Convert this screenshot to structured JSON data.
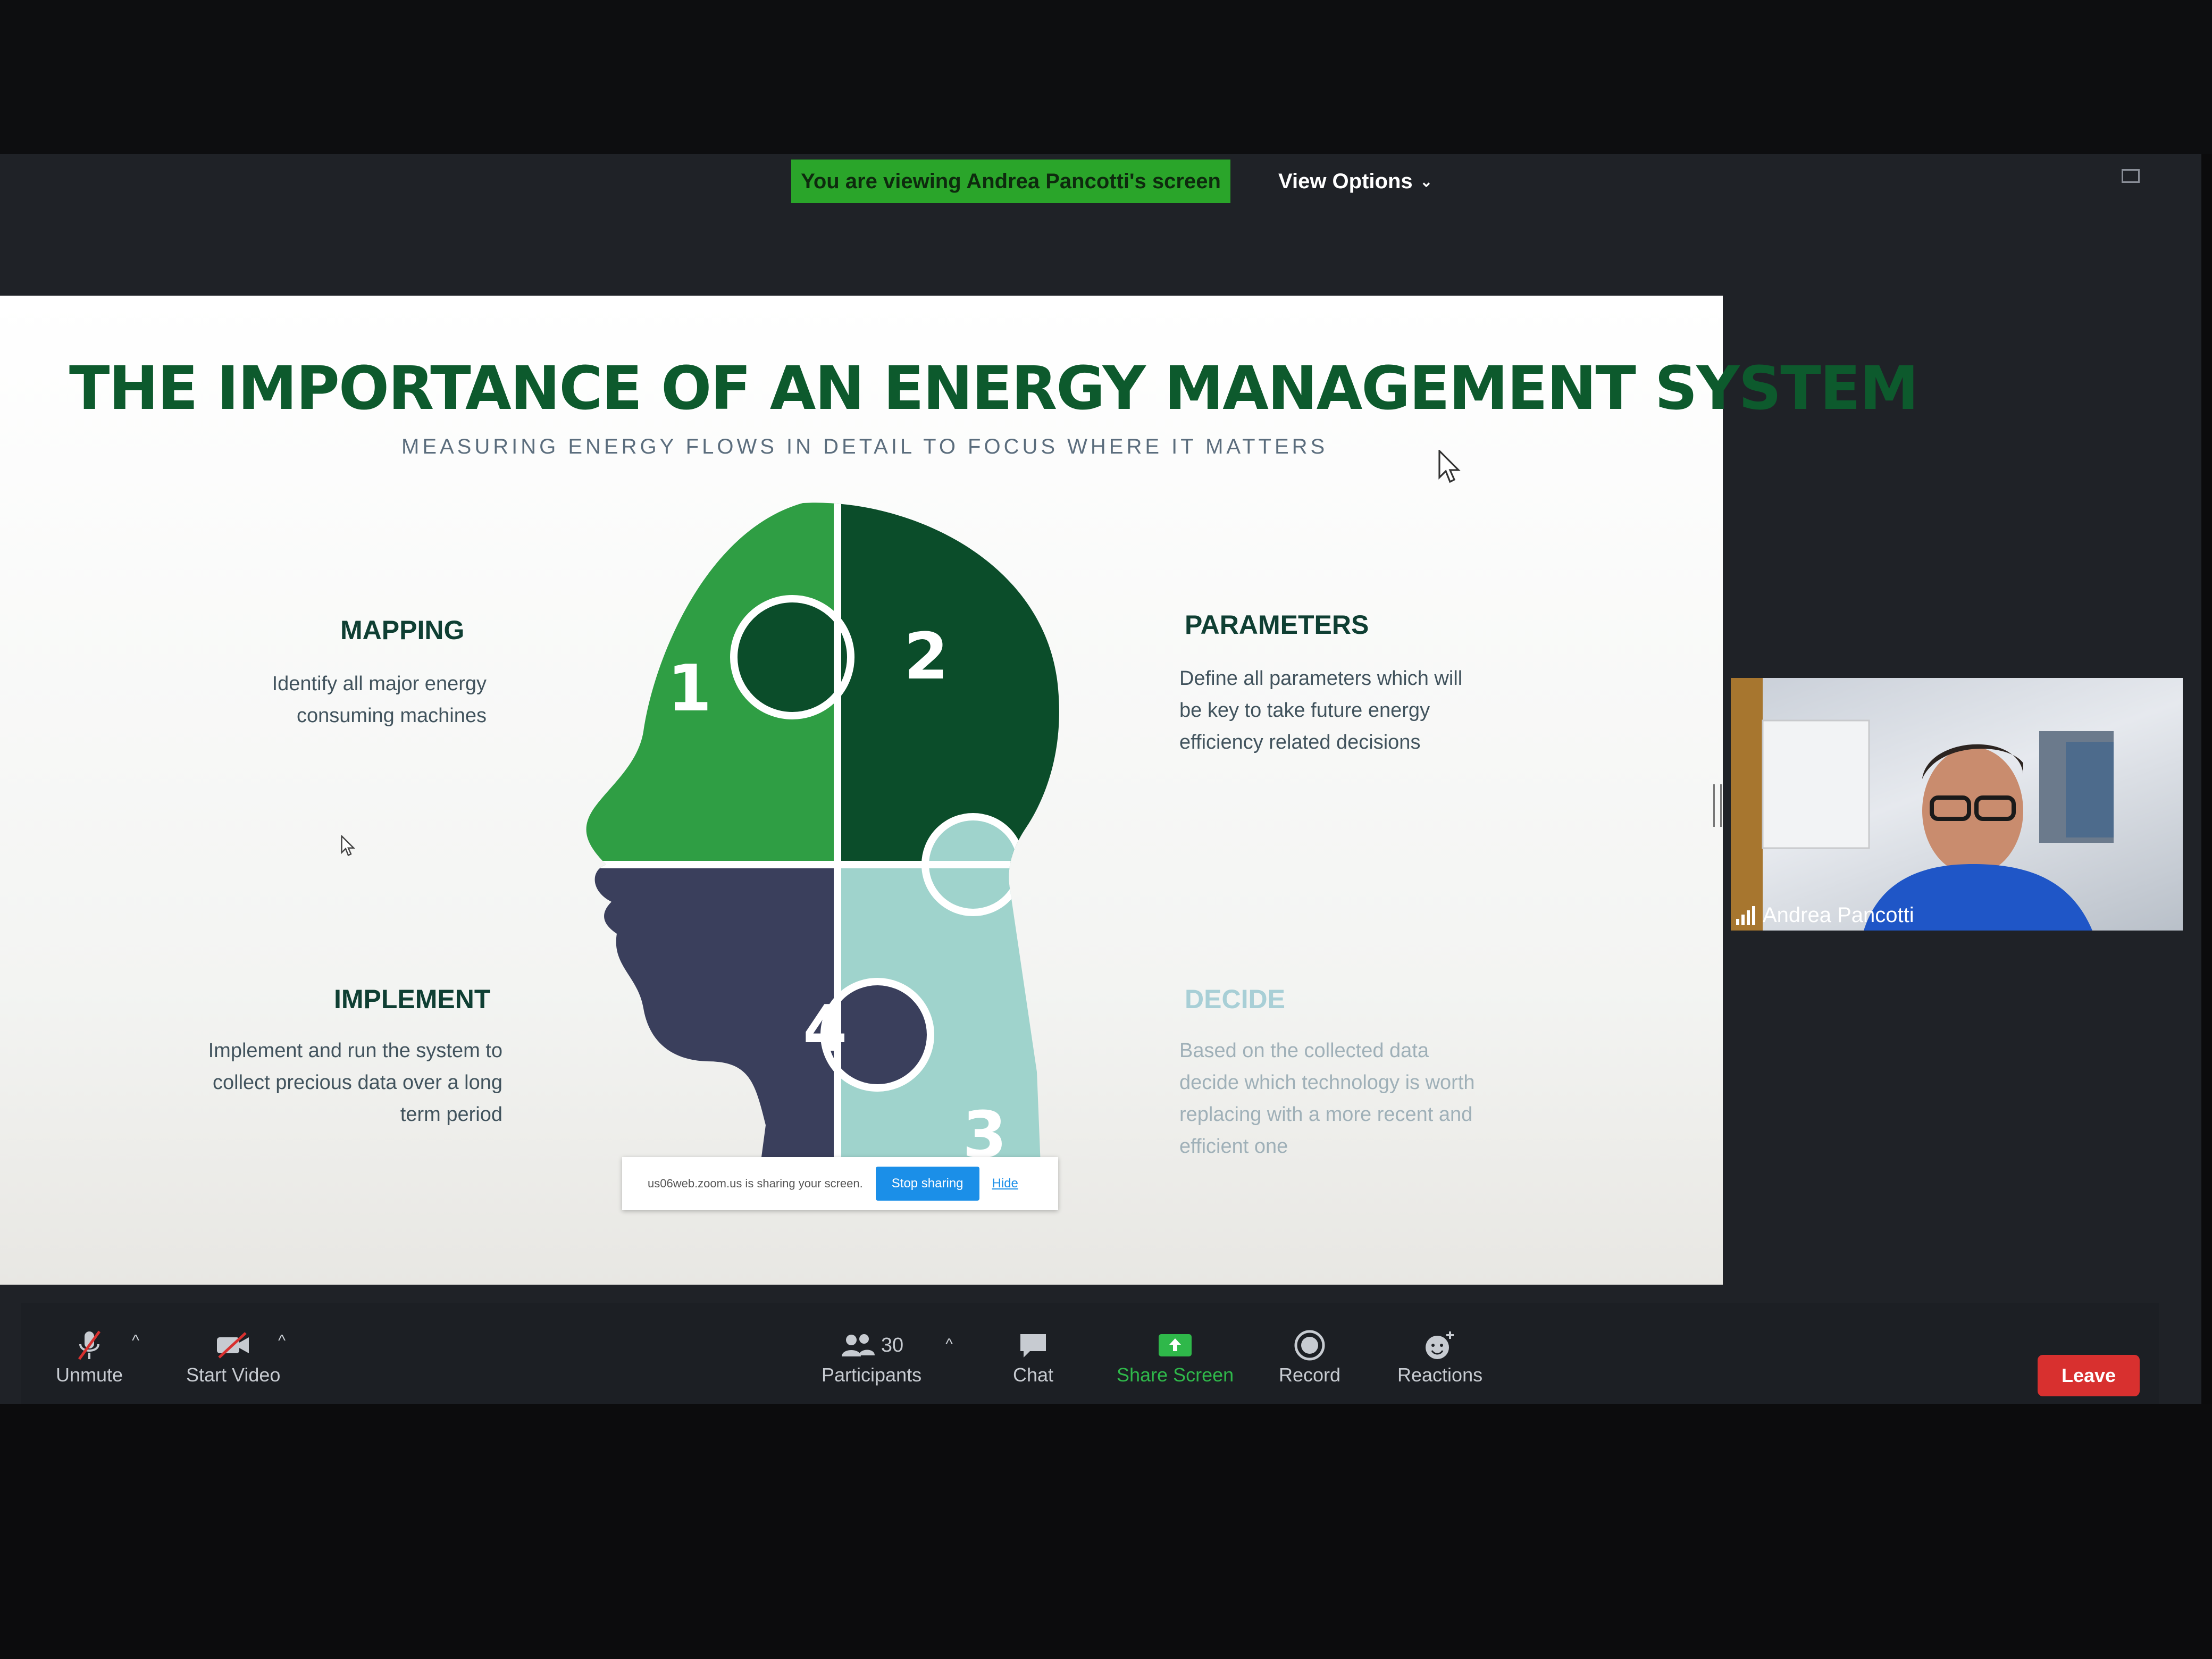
{
  "banner": {
    "viewing_text": "You are viewing Andrea Pancotti's screen",
    "view_options": "View Options"
  },
  "slide": {
    "title": "THE IMPORTANCE OF AN ENERGY MANAGEMENT SYSTEM",
    "subtitle": "MEASURING ENERGY FLOWS IN DETAIL TO FOCUS WHERE IT MATTERS",
    "sections": {
      "mapping": {
        "title": "MAPPING",
        "lines": [
          "Identify all major energy",
          "consuming machines"
        ]
      },
      "parameters": {
        "title": "PARAMETERS",
        "lines": [
          "Define all parameters which will",
          "be key to take future energy",
          "efficiency related decisions"
        ]
      },
      "implement": {
        "title": "IMPLEMENT",
        "lines": [
          "Implement and run the system to",
          "collect precious data over a long",
          "term period"
        ]
      },
      "decide": {
        "title": "DECIDE",
        "lines": [
          "Based on the collected data",
          "decide which technology is worth",
          "replacing with a more recent and",
          "efficient one"
        ]
      }
    },
    "puzzle_numbers": [
      "1",
      "2",
      "3",
      "4"
    ],
    "colors": {
      "title_green": "#0d5a2d",
      "piece1": "#2f9e44",
      "piece2": "#0b4d2a",
      "piece3": "#9fd3cc",
      "piece4": "#3a3f5c"
    }
  },
  "share_bar": {
    "text": "us06web.zoom.us is sharing your screen.",
    "stop": "Stop sharing",
    "hide": "Hide"
  },
  "video": {
    "participant_name": "Andrea Pancotti"
  },
  "toolbar": {
    "unmute": "Unmute",
    "start_video": "Start Video",
    "participants": "Participants",
    "participants_count": "30",
    "chat": "Chat",
    "share_screen": "Share Screen",
    "record": "Record",
    "reactions": "Reactions",
    "leave": "Leave"
  }
}
